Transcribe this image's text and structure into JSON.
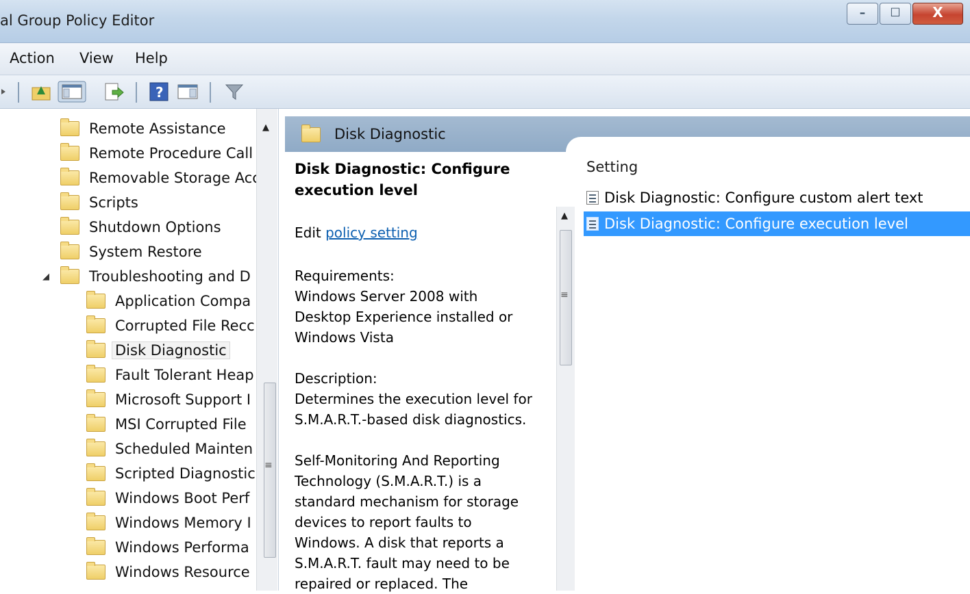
{
  "window": {
    "title": "al Group Policy Editor",
    "controls": {
      "minimize": "–",
      "maximize": "☐",
      "close": "X"
    }
  },
  "menu": {
    "items": [
      "Action",
      "View",
      "Help"
    ]
  },
  "tree": {
    "items": [
      {
        "label": "Remote Assistance"
      },
      {
        "label": "Remote Procedure Call"
      },
      {
        "label": "Removable Storage Acc"
      },
      {
        "label": "Scripts"
      },
      {
        "label": "Shutdown Options"
      },
      {
        "label": "System Restore"
      },
      {
        "label": "Troubleshooting and D"
      },
      {
        "label": "Application Compa"
      },
      {
        "label": "Corrupted File Recc"
      },
      {
        "label": "Disk Diagnostic"
      },
      {
        "label": "Fault Tolerant Heap"
      },
      {
        "label": "Microsoft Support I"
      },
      {
        "label": "MSI Corrupted File"
      },
      {
        "label": "Scheduled Mainten"
      },
      {
        "label": "Scripted Diagnostic"
      },
      {
        "label": "Windows Boot Perf"
      },
      {
        "label": "Windows Memory I"
      },
      {
        "label": "Windows Performa"
      },
      {
        "label": "Windows Resource"
      }
    ],
    "expander": "◢"
  },
  "header": {
    "title": "Disk Diagnostic"
  },
  "description": {
    "title": "Disk Diagnostic: Configure execution level",
    "edit_prefix": "Edit",
    "edit_link": "policy setting",
    "requirements_label": "Requirements:",
    "requirements_lines": [
      "Windows Server 2008 with",
      "Desktop Experience installed or",
      "Windows Vista"
    ],
    "description_label": "Description:",
    "description_lines": [
      "Determines the execution level for",
      "S.M.A.R.T.-based disk diagnostics."
    ],
    "body_lines": [
      "Self-Monitoring And Reporting",
      "Technology (S.M.A.R.T.) is a",
      "standard mechanism for storage",
      "devices to report faults to",
      "Windows.  A disk that reports a",
      "S.M.A.R.T. fault may need to be",
      "repaired or replaced.  The"
    ]
  },
  "settings": {
    "column_header": "Setting",
    "rows": [
      {
        "label": "Disk Diagnostic: Configure custom alert text",
        "selected": false
      },
      {
        "label": "Disk Diagnostic: Configure execution level",
        "selected": true
      }
    ]
  },
  "scroll_glyphs": {
    "up": "▲",
    "grip": "≡"
  }
}
